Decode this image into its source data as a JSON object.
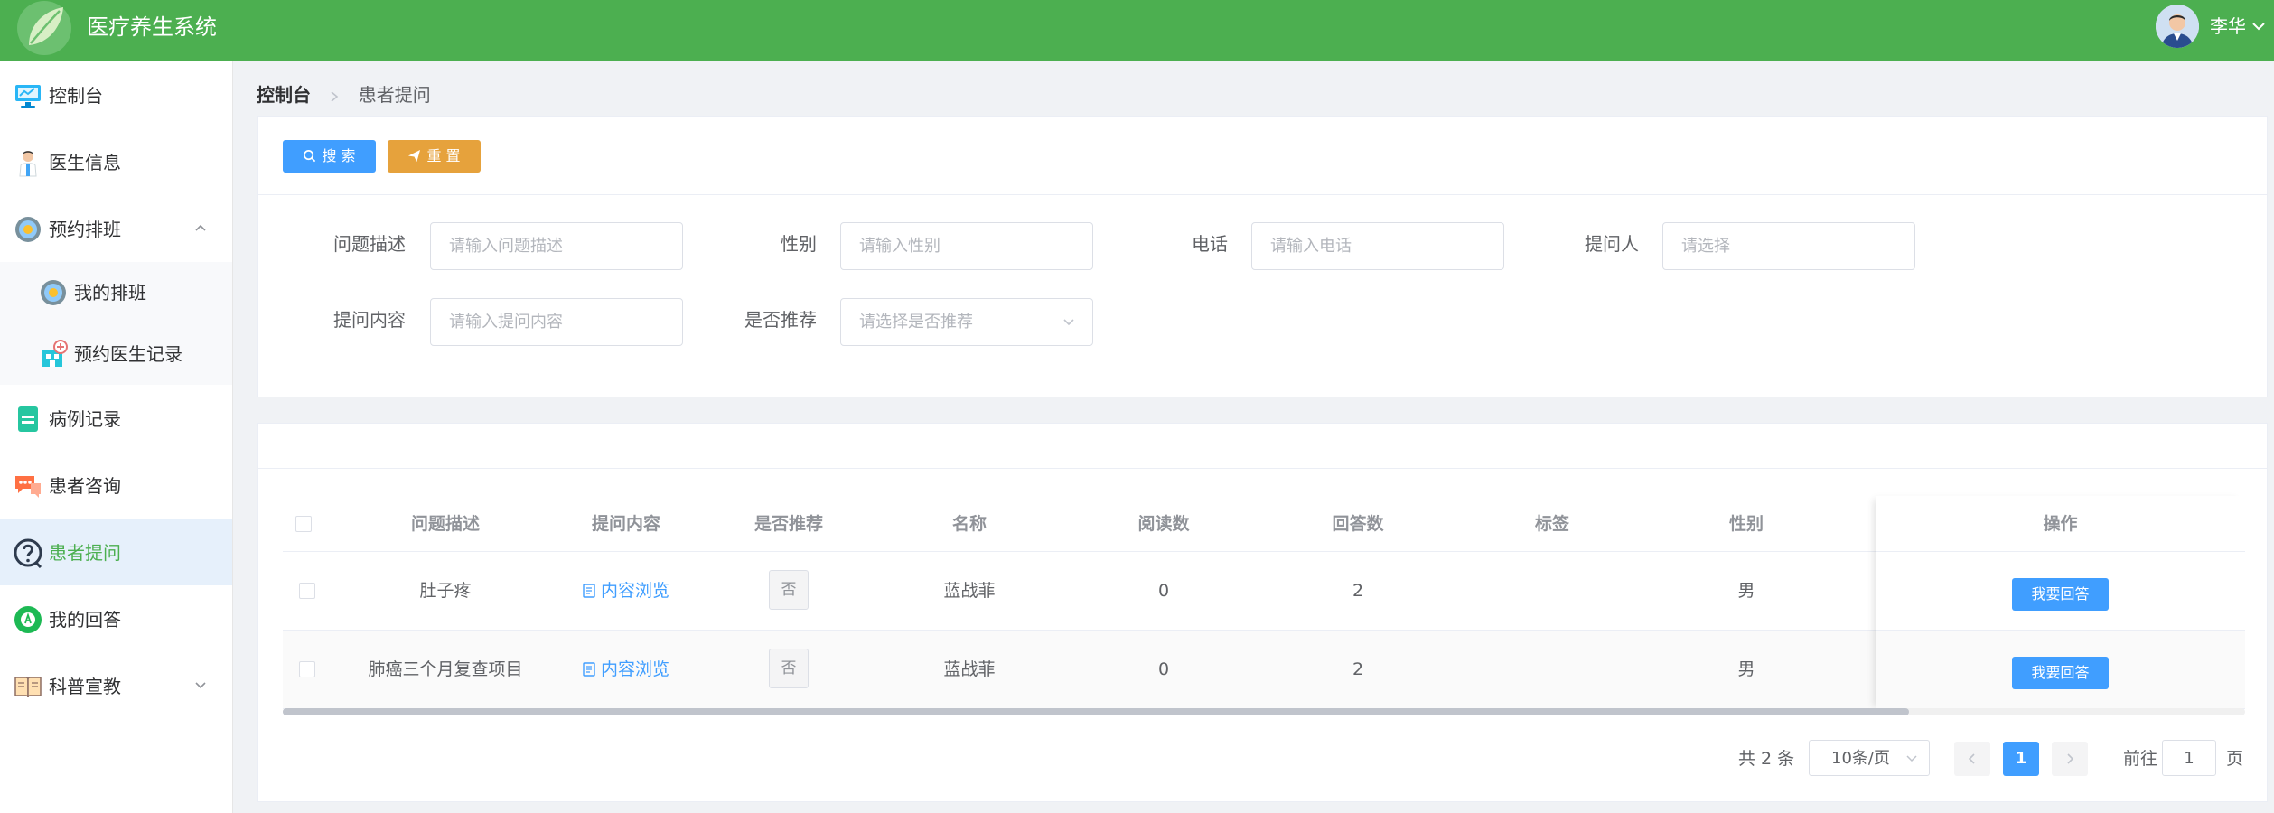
{
  "app": {
    "title": "医疗养生系统"
  },
  "user": {
    "name": "李华"
  },
  "sidebar": {
    "items": [
      {
        "label": "控制台"
      },
      {
        "label": "医生信息"
      },
      {
        "label": "预约排班"
      },
      {
        "label": "病例记录"
      },
      {
        "label": "患者咨询"
      },
      {
        "label": "患者提问"
      },
      {
        "label": "我的回答"
      },
      {
        "label": "科普宣教"
      }
    ],
    "subitems": [
      {
        "label": "我的排班"
      },
      {
        "label": "预约医生记录"
      }
    ],
    "active": "患者提问"
  },
  "breadcrumb": {
    "home": "控制台",
    "current": "患者提问"
  },
  "toolbar": {
    "search_label": "搜 索",
    "reset_label": "重 置"
  },
  "filters": {
    "description": {
      "label": "问题描述",
      "placeholder": "请输入问题描述"
    },
    "gender": {
      "label": "性别",
      "placeholder": "请输入性别"
    },
    "phone": {
      "label": "电话",
      "placeholder": "请输入电话"
    },
    "asker": {
      "label": "提问人",
      "placeholder": "请选择"
    },
    "content": {
      "label": "提问内容",
      "placeholder": "请输入提问内容"
    },
    "recommend": {
      "label": "是否推荐",
      "placeholder": "请选择是否推荐"
    }
  },
  "table": {
    "headers": {
      "description": "问题描述",
      "content": "提问内容",
      "recommend": "是否推荐",
      "name": "名称",
      "reads": "阅读数",
      "answers": "回答数",
      "tags": "标签",
      "gender": "性别",
      "actions": "操作"
    },
    "rows": [
      {
        "description": "肚子疼",
        "content": "内容浏览",
        "recommend": "否",
        "name": "蓝战菲",
        "reads": "0",
        "answers": "2",
        "tags": "",
        "gender": "男",
        "action": "我要回答"
      },
      {
        "description": "肺癌三个月复查项目",
        "content": "内容浏览",
        "recommend": "否",
        "name": "蓝战菲",
        "reads": "0",
        "answers": "2",
        "tags": "",
        "gender": "男",
        "action": "我要回答"
      }
    ]
  },
  "pagination": {
    "total": "共 2 条",
    "page_size": "10条/页",
    "current_page": "1",
    "goto_prefix": "前往",
    "goto_value": "1",
    "goto_suffix": "页"
  },
  "colors": {
    "header": "#4caf50",
    "primary": "#409eff",
    "warning": "#e6a23c"
  }
}
